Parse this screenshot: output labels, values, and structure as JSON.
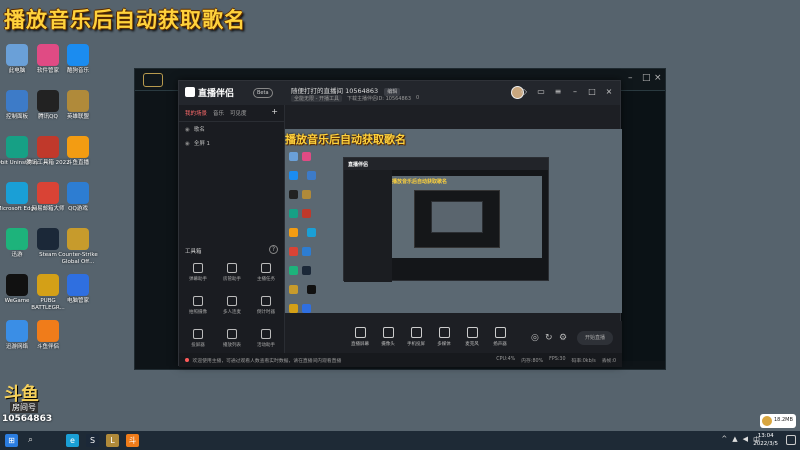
{
  "overlay_title": "播放音乐后自动获取歌名",
  "desktop_icons": [
    {
      "label": "此电脑",
      "icon": "computer-icon",
      "color": "#6aa0d8"
    },
    {
      "label": "软件管家",
      "icon": "software-manager-icon",
      "color": "#e04b84"
    },
    {
      "label": "酷狗音乐",
      "icon": "kugou-icon",
      "color": "#1b8cf0"
    },
    {
      "label": "控制面板",
      "icon": "control-panel-icon",
      "color": "#3d7bc8"
    },
    {
      "label": "腾讯QQ",
      "icon": "qq-icon",
      "color": "#222222"
    },
    {
      "label": "英雄联盟",
      "icon": "lol-icon",
      "color": "#b08a3a"
    },
    {
      "label": "IObit Uninstaller",
      "icon": "iobit-icon",
      "color": "#16a085"
    },
    {
      "label": "腾讯工具箱 2022",
      "icon": "toolbox-icon",
      "color": "#c0392b"
    },
    {
      "label": "斗鱼直播",
      "icon": "douyu-icon",
      "color": "#f39c12"
    },
    {
      "label": "Microsoft Edge",
      "icon": "edge-icon",
      "color": "#1a9fd6"
    },
    {
      "label": "网易邮箱大师",
      "icon": "mail-master-icon",
      "color": "#d94335"
    },
    {
      "label": "QQ游戏",
      "icon": "qq-game-icon",
      "color": "#2d7dd2"
    },
    {
      "label": "迅游",
      "icon": "xunyou-icon",
      "color": "#1db37b"
    },
    {
      "label": "Steam",
      "icon": "steam-icon",
      "color": "#1b2838"
    },
    {
      "label": "Counter-Strike Global Off...",
      "icon": "csgo-icon",
      "color": "#c79b2c"
    },
    {
      "label": "WeGame",
      "icon": "wegame-icon",
      "color": "#111111"
    },
    {
      "label": "PUBG BATTLEGR...",
      "icon": "pubg-icon",
      "color": "#d4a017"
    },
    {
      "label": "电脑管家",
      "icon": "pc-manager-icon",
      "color": "#2f6fe0"
    },
    {
      "label": "迅游网络",
      "icon": "network-icon",
      "color": "#3a8ee6"
    },
    {
      "label": "斗鱼伴侣",
      "icon": "douyu-companion-icon",
      "color": "#f07c1a"
    }
  ],
  "app": {
    "name": "直播伴侣",
    "beta": "Beta",
    "tabs": [
      "我的场景",
      "音乐",
      "可见度"
    ],
    "scenes": [
      "歌名",
      "全屏 1"
    ],
    "tools_title": "工具箱",
    "tools": [
      {
        "label": "弹幕助手",
        "icon": "danmaku-icon"
      },
      {
        "label": "房管助手",
        "icon": "room-manager-icon"
      },
      {
        "label": "主播任务",
        "icon": "task-icon"
      },
      {
        "label": "拍照摄像",
        "icon": "camera-tool-icon"
      },
      {
        "label": "多人连麦",
        "icon": "multi-mic-icon"
      },
      {
        "label": "倒计时器",
        "icon": "timer-icon"
      },
      {
        "label": "投屏器",
        "icon": "cast-icon"
      },
      {
        "label": "播放列表",
        "icon": "playlist-icon"
      },
      {
        "label": "活动助手",
        "icon": "activity-icon"
      }
    ],
    "room_title": "随便打打的直播间 10564863",
    "edit_label": "编辑",
    "sub_chips": [
      "全能无限 - 开播工具",
      "下载主播伴侣ID: 10564863",
      "0"
    ],
    "bottom_buttons": [
      {
        "label": "直播屏幕",
        "icon": "screen-icon"
      },
      {
        "label": "摄像头",
        "icon": "webcam-icon"
      },
      {
        "label": "手机投屏",
        "icon": "phone-cast-icon"
      },
      {
        "label": "多媒体",
        "icon": "media-icon"
      },
      {
        "label": "麦克风",
        "icon": "mic-icon"
      },
      {
        "label": "扬声器",
        "icon": "speaker-icon"
      }
    ],
    "live_label": "开始直播",
    "status_text": "欢迎使用主播，可通过观看人数查看实时数据，请在直播间内观看直播",
    "status_right": [
      "CPU:4%",
      "内存:80%",
      "FPS:30",
      "码率:0kb/s",
      "丢帧:0"
    ]
  },
  "watermark": {
    "room_label": "房间号",
    "room_id": "10564863"
  },
  "taskbar": {
    "time": "13:04",
    "date": "2022/3/5",
    "apps": [
      "start-icon",
      "search-icon",
      "edge-icon",
      "steam-icon",
      "lol-icon",
      "douyu-companion-icon"
    ]
  },
  "badge_widget": {
    "value": "18.2MB"
  }
}
